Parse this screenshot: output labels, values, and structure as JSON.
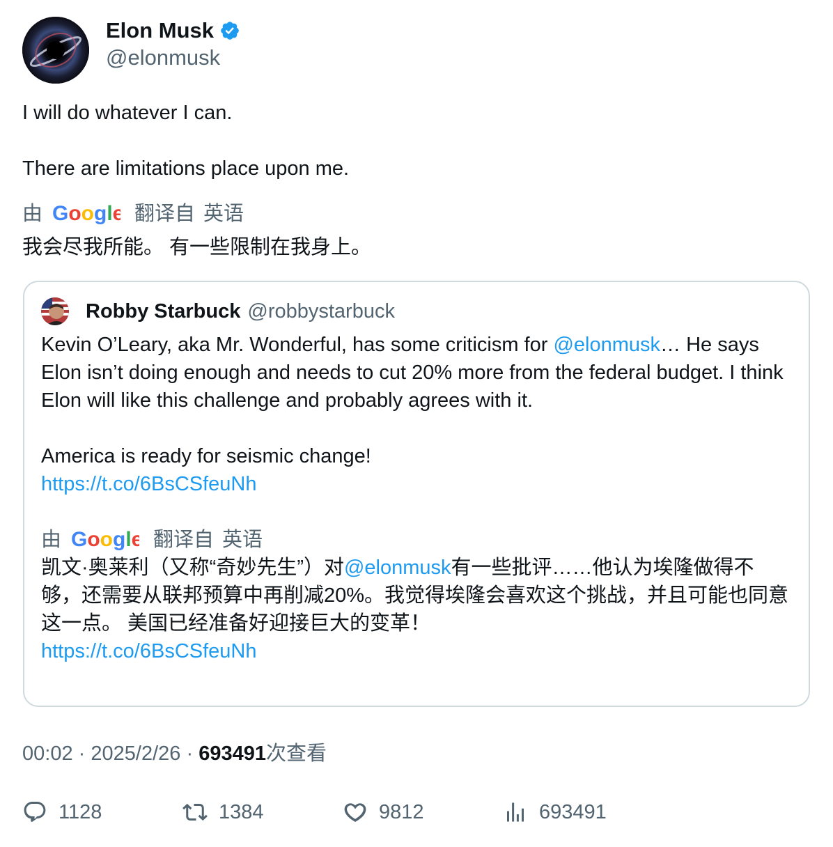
{
  "author": {
    "name": "Elon Musk",
    "handle": "@elonmusk"
  },
  "tweet": {
    "lines": [
      "I will do whatever I can.",
      "There are limitations place upon me."
    ]
  },
  "translation": {
    "by": "由",
    "google": "Google",
    "translated_from": "翻译自",
    "language": "英语",
    "text": "我会尽我所能。 有一些限制在我身上。"
  },
  "quote": {
    "name": "Robby Starbuck",
    "handle": "@robbystarbuck",
    "text_before_mention": "Kevin O’Leary, aka Mr. Wonderful, has some criticism for ",
    "mention": "@elonmusk",
    "text_after_mention": "… He says Elon isn’t doing enough and needs to cut 20% more from the federal budget. I think Elon will like this challenge and probably agrees with it.",
    "line2": "America is ready for seismic change!",
    "link": "https://t.co/6BsCSfeuNh",
    "translation": {
      "by": "由",
      "google": "Google",
      "translated_from": "翻译自",
      "language": "英语",
      "text_before_mention": "凯文·奥莱利（又称“奇妙先生”）对",
      "mention": "@elonmusk",
      "text_after_mention": "有一些批评……他认为埃隆做得不够，还需要从联邦预算中再削减20%。我觉得埃隆会喜欢这个挑战，并且可能也同意这一点。 美国已经准备好迎接巨大的变革！",
      "link": "https://t.co/6BsCSfeuNh"
    }
  },
  "meta": {
    "time": "00:02",
    "separator": "·",
    "date": "2025/2/26",
    "views": "693491",
    "views_suffix": "次查看"
  },
  "actions": {
    "replies": "1128",
    "reposts": "1384",
    "likes": "9812",
    "views": "693491"
  },
  "colors": {
    "link": "#1d9bf0",
    "secondary": "#536471",
    "verified": "#1d9bf0"
  }
}
